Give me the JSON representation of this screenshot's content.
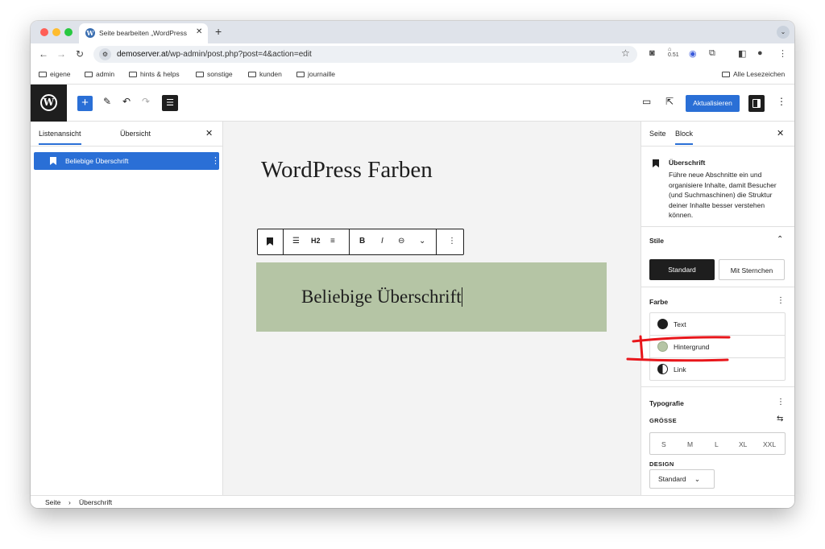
{
  "browser": {
    "tab_title": "Seite bearbeiten „WordPress",
    "tab_favicon": "W",
    "url_prefix": "demoserver.at",
    "url_path": "/wp-admin/post.php?post=4&action=edit",
    "bookmarks": [
      "eigene",
      "admin",
      "hints & helps",
      "sonstige",
      "kunden",
      "journaille"
    ],
    "all_bookmarks": "Alle Lesezeichen",
    "ext_badge": "0.51"
  },
  "wp_header": {
    "logo": "W",
    "update_label": "Aktualisieren"
  },
  "list_view": {
    "tab_list": "Listenansicht",
    "tab_overview": "Übersicht",
    "item_label": "Beliebige Überschrift"
  },
  "canvas": {
    "post_title": "WordPress Farben",
    "heading_text": "Beliebige Überschrift",
    "toolbar_level": "H2",
    "heading_bg": "#b5c5a5"
  },
  "sidebar": {
    "tab_page": "Seite",
    "tab_block": "Block",
    "block_title": "Überschrift",
    "block_desc": "Führe neue Abschnitte ein und organisiere Inhalte, damit Besucher (und Suchmaschinen) die Struktur deiner Inhalte besser verstehen können.",
    "styles_title": "Stile",
    "style_standard": "Standard",
    "style_stars": "Mit Sternchen",
    "color_title": "Farbe",
    "color_text": "Text",
    "color_bg": "Hintergrund",
    "color_link": "Link",
    "typo_title": "Typografie",
    "size_label": "GRÖSSE",
    "sizes": [
      "S",
      "M",
      "L",
      "XL",
      "XXL"
    ],
    "design_label": "DESIGN",
    "design_value": "Standard"
  },
  "footer": {
    "crumb_1": "Seite",
    "crumb_2": "Überschrift"
  },
  "colors": {
    "accent": "#2a6fd6",
    "heading_background": "#b5c5a5",
    "annotation": "#e8161b"
  }
}
